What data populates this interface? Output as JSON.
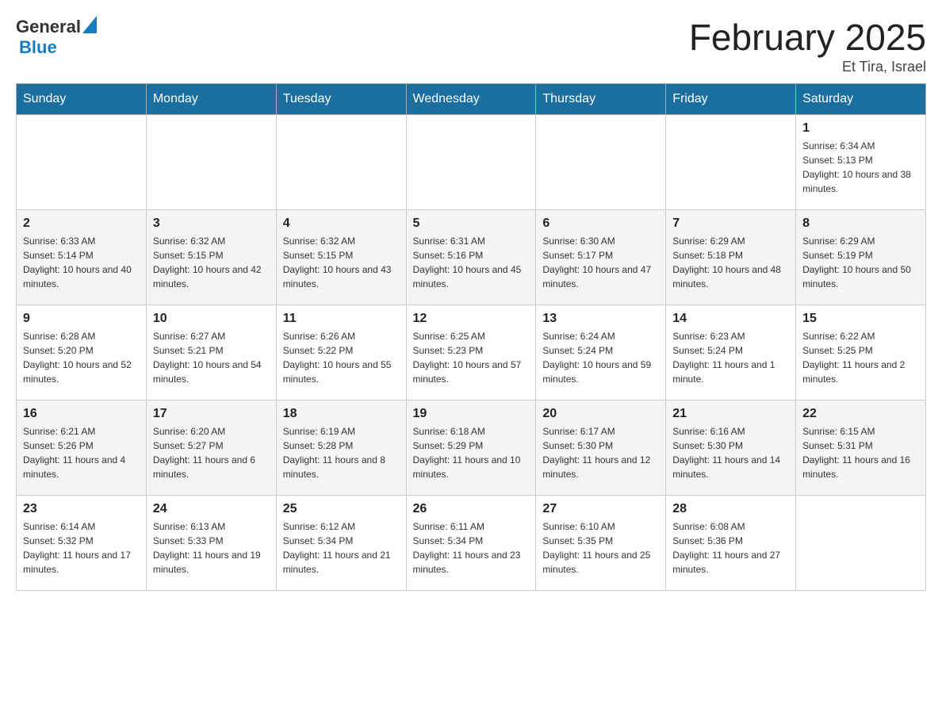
{
  "header": {
    "logo_general": "General",
    "logo_blue": "Blue",
    "month_title": "February 2025",
    "location": "Et Tira, Israel"
  },
  "weekdays": [
    "Sunday",
    "Monday",
    "Tuesday",
    "Wednesday",
    "Thursday",
    "Friday",
    "Saturday"
  ],
  "weeks": [
    {
      "days": [
        {
          "number": "",
          "info": ""
        },
        {
          "number": "",
          "info": ""
        },
        {
          "number": "",
          "info": ""
        },
        {
          "number": "",
          "info": ""
        },
        {
          "number": "",
          "info": ""
        },
        {
          "number": "",
          "info": ""
        },
        {
          "number": "1",
          "info": "Sunrise: 6:34 AM\nSunset: 5:13 PM\nDaylight: 10 hours and 38 minutes."
        }
      ]
    },
    {
      "days": [
        {
          "number": "2",
          "info": "Sunrise: 6:33 AM\nSunset: 5:14 PM\nDaylight: 10 hours and 40 minutes."
        },
        {
          "number": "3",
          "info": "Sunrise: 6:32 AM\nSunset: 5:15 PM\nDaylight: 10 hours and 42 minutes."
        },
        {
          "number": "4",
          "info": "Sunrise: 6:32 AM\nSunset: 5:15 PM\nDaylight: 10 hours and 43 minutes."
        },
        {
          "number": "5",
          "info": "Sunrise: 6:31 AM\nSunset: 5:16 PM\nDaylight: 10 hours and 45 minutes."
        },
        {
          "number": "6",
          "info": "Sunrise: 6:30 AM\nSunset: 5:17 PM\nDaylight: 10 hours and 47 minutes."
        },
        {
          "number": "7",
          "info": "Sunrise: 6:29 AM\nSunset: 5:18 PM\nDaylight: 10 hours and 48 minutes."
        },
        {
          "number": "8",
          "info": "Sunrise: 6:29 AM\nSunset: 5:19 PM\nDaylight: 10 hours and 50 minutes."
        }
      ]
    },
    {
      "days": [
        {
          "number": "9",
          "info": "Sunrise: 6:28 AM\nSunset: 5:20 PM\nDaylight: 10 hours and 52 minutes."
        },
        {
          "number": "10",
          "info": "Sunrise: 6:27 AM\nSunset: 5:21 PM\nDaylight: 10 hours and 54 minutes."
        },
        {
          "number": "11",
          "info": "Sunrise: 6:26 AM\nSunset: 5:22 PM\nDaylight: 10 hours and 55 minutes."
        },
        {
          "number": "12",
          "info": "Sunrise: 6:25 AM\nSunset: 5:23 PM\nDaylight: 10 hours and 57 minutes."
        },
        {
          "number": "13",
          "info": "Sunrise: 6:24 AM\nSunset: 5:24 PM\nDaylight: 10 hours and 59 minutes."
        },
        {
          "number": "14",
          "info": "Sunrise: 6:23 AM\nSunset: 5:24 PM\nDaylight: 11 hours and 1 minute."
        },
        {
          "number": "15",
          "info": "Sunrise: 6:22 AM\nSunset: 5:25 PM\nDaylight: 11 hours and 2 minutes."
        }
      ]
    },
    {
      "days": [
        {
          "number": "16",
          "info": "Sunrise: 6:21 AM\nSunset: 5:26 PM\nDaylight: 11 hours and 4 minutes."
        },
        {
          "number": "17",
          "info": "Sunrise: 6:20 AM\nSunset: 5:27 PM\nDaylight: 11 hours and 6 minutes."
        },
        {
          "number": "18",
          "info": "Sunrise: 6:19 AM\nSunset: 5:28 PM\nDaylight: 11 hours and 8 minutes."
        },
        {
          "number": "19",
          "info": "Sunrise: 6:18 AM\nSunset: 5:29 PM\nDaylight: 11 hours and 10 minutes."
        },
        {
          "number": "20",
          "info": "Sunrise: 6:17 AM\nSunset: 5:30 PM\nDaylight: 11 hours and 12 minutes."
        },
        {
          "number": "21",
          "info": "Sunrise: 6:16 AM\nSunset: 5:30 PM\nDaylight: 11 hours and 14 minutes."
        },
        {
          "number": "22",
          "info": "Sunrise: 6:15 AM\nSunset: 5:31 PM\nDaylight: 11 hours and 16 minutes."
        }
      ]
    },
    {
      "days": [
        {
          "number": "23",
          "info": "Sunrise: 6:14 AM\nSunset: 5:32 PM\nDaylight: 11 hours and 17 minutes."
        },
        {
          "number": "24",
          "info": "Sunrise: 6:13 AM\nSunset: 5:33 PM\nDaylight: 11 hours and 19 minutes."
        },
        {
          "number": "25",
          "info": "Sunrise: 6:12 AM\nSunset: 5:34 PM\nDaylight: 11 hours and 21 minutes."
        },
        {
          "number": "26",
          "info": "Sunrise: 6:11 AM\nSunset: 5:34 PM\nDaylight: 11 hours and 23 minutes."
        },
        {
          "number": "27",
          "info": "Sunrise: 6:10 AM\nSunset: 5:35 PM\nDaylight: 11 hours and 25 minutes."
        },
        {
          "number": "28",
          "info": "Sunrise: 6:08 AM\nSunset: 5:36 PM\nDaylight: 11 hours and 27 minutes."
        },
        {
          "number": "",
          "info": ""
        }
      ]
    }
  ]
}
